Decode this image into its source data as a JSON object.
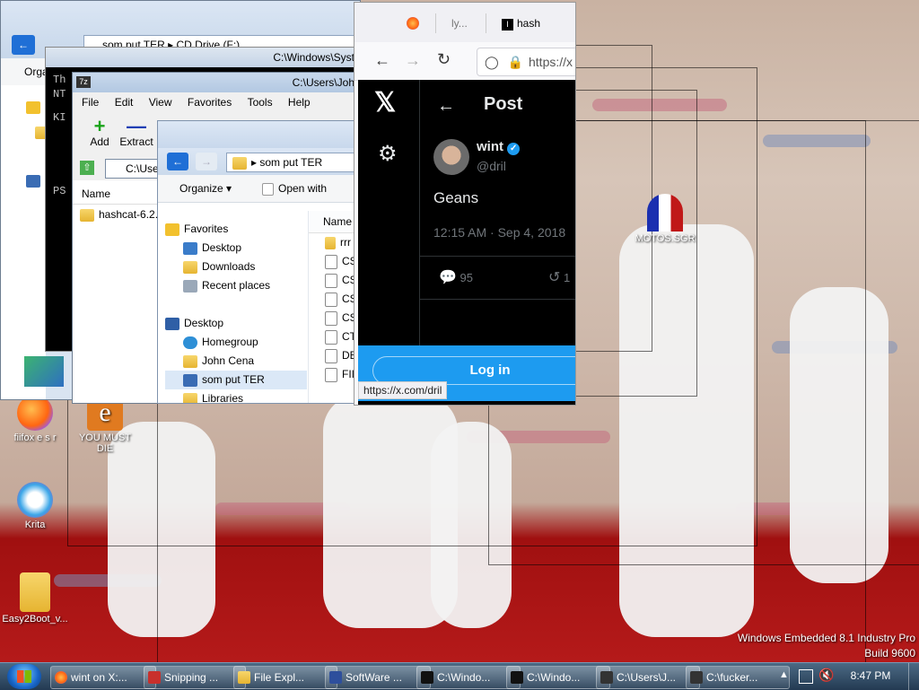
{
  "desktop": {
    "icons": [
      {
        "label": "fiifox e s r"
      },
      {
        "label": "YOU MUST DIE"
      },
      {
        "label": "Krita"
      },
      {
        "label": "Easy2Boot_v..."
      },
      {
        "label": "MOTOS.SGR"
      }
    ],
    "watermark": {
      "line1": "Windows Embedded 8.1 Industry Pro",
      "line2": "Build 9600"
    }
  },
  "back_explorer": {
    "breadcrumb": [
      "som put TER",
      "CD Drive (F:)"
    ],
    "organize_label": "Orga"
  },
  "cmd_window": {
    "title": "C:\\Windows\\Syst",
    "lines": [
      "Th",
      "NT",
      "KI",
      "PS"
    ]
  },
  "sevenzip": {
    "title": "C:\\Users\\Joh",
    "menu": [
      "File",
      "Edit",
      "View",
      "Favorites",
      "Tools",
      "Help"
    ],
    "toolbar": [
      {
        "label": "Add"
      },
      {
        "label": "Extract"
      }
    ],
    "address": "C:\\Use",
    "column_name": "Name",
    "rows": [
      "hashcat-6.2.6"
    ]
  },
  "explorer": {
    "breadcrumb": "som put TER",
    "organize_label": "Organize",
    "open_with_label": "Open with",
    "nav": {
      "favorites_label": "Favorites",
      "favorites": [
        "Desktop",
        "Downloads",
        "Recent places"
      ],
      "desktop_label": "Desktop",
      "desktop_items": [
        "Homegroup",
        "John Cena",
        "som put TER",
        "Libraries"
      ]
    },
    "column_name": "Name",
    "files": [
      "rrr",
      "CS",
      "CS",
      "CS",
      "CS",
      "CT",
      "DE",
      "FII"
    ]
  },
  "browser": {
    "tabs": [
      {
        "label": "ly..."
      },
      {
        "label": "hash"
      }
    ],
    "url": "https://x",
    "status_url": "https://x.com/dril",
    "header_title": "Post",
    "post": {
      "display_name": "wint",
      "handle": "@dril",
      "text": "Geans",
      "timestamp": "12:15 AM · Sep 4, 2018",
      "reply_count": "95",
      "retweet_count": "1"
    },
    "login_label": "Log in",
    "logo_glyph": "𝕏"
  },
  "taskbar": {
    "buttons": [
      {
        "label": "wint on X:..."
      },
      {
        "label": "Snipping ..."
      },
      {
        "label": "File Expl..."
      },
      {
        "label": "SoftWare ..."
      },
      {
        "label": "C:\\Windo..."
      },
      {
        "label": "C:\\Windo..."
      },
      {
        "label": "C:\\Users\\J..."
      },
      {
        "label": "C:\\fucker..."
      }
    ],
    "clock": "8:47 PM"
  }
}
